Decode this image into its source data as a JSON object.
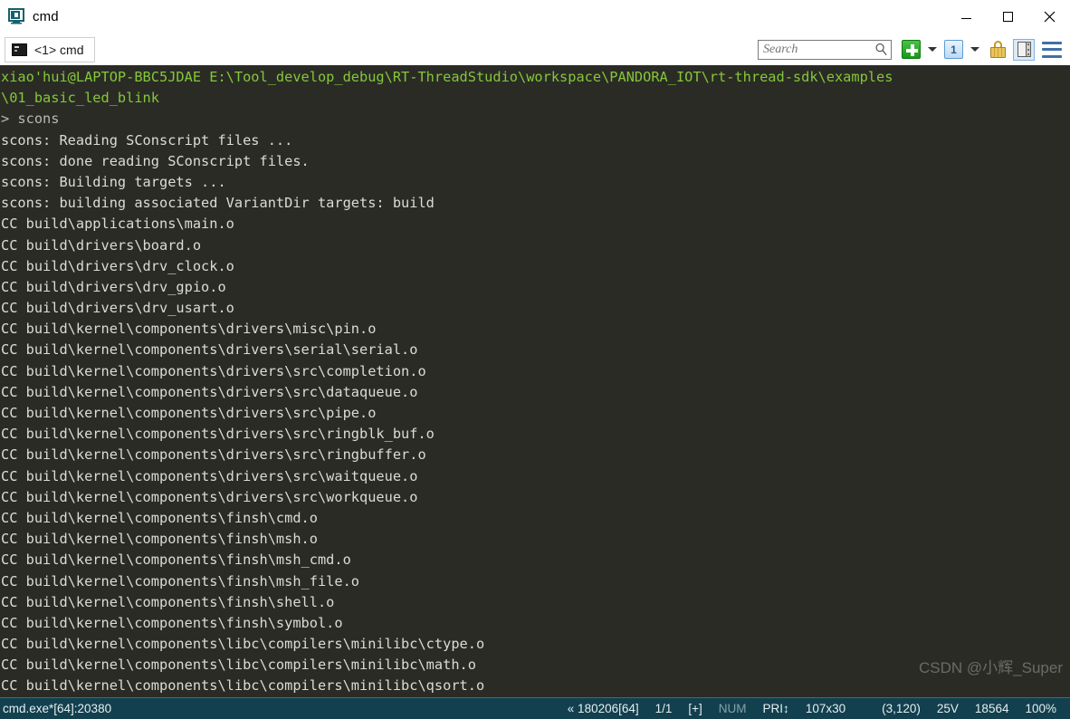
{
  "window": {
    "title": "cmd",
    "icon": "console-app-icon",
    "controls": {
      "minimize": "Minimize",
      "maximize": "Maximize",
      "close": "Close"
    }
  },
  "tabs": [
    {
      "label": "<1> cmd",
      "icon": "console-icon",
      "active": true
    }
  ],
  "toolbar": {
    "search": {
      "placeholder": "Search",
      "value": ""
    },
    "search_icon": "magnifier-icon",
    "new_console_button": "new-console-icon",
    "new_console_caret": "chevron-down-icon",
    "active_console_button": "1",
    "active_console_caret": "chevron-down-icon",
    "lock_button": "lock-icon",
    "panel_button": "toggle-panel-icon",
    "menu_button": "hamburger-menu-icon"
  },
  "terminal": {
    "background": "#2b2b26",
    "prompt_color": "#84c838",
    "text_color": "#dcdcd2",
    "lines": [
      {
        "text": "xiao'hui@LAPTOP-BBC5JDAE E:\\Tool_develop_debug\\RT-ThreadStudio\\workspace\\PANDORA_IOT\\rt-thread-sdk\\examples",
        "style": "prompt"
      },
      {
        "text": "\\01_basic_led_blink",
        "style": "prompt"
      },
      {
        "text": "> scons",
        "style": "gray"
      },
      {
        "text": "scons: Reading SConscript files ...",
        "style": "out"
      },
      {
        "text": "scons: done reading SConscript files.",
        "style": "out"
      },
      {
        "text": "scons: Building targets ...",
        "style": "out"
      },
      {
        "text": "scons: building associated VariantDir targets: build",
        "style": "out"
      },
      {
        "text": "CC build\\applications\\main.o",
        "style": "out"
      },
      {
        "text": "CC build\\drivers\\board.o",
        "style": "out"
      },
      {
        "text": "CC build\\drivers\\drv_clock.o",
        "style": "out"
      },
      {
        "text": "CC build\\drivers\\drv_gpio.o",
        "style": "out"
      },
      {
        "text": "CC build\\drivers\\drv_usart.o",
        "style": "out"
      },
      {
        "text": "CC build\\kernel\\components\\drivers\\misc\\pin.o",
        "style": "out"
      },
      {
        "text": "CC build\\kernel\\components\\drivers\\serial\\serial.o",
        "style": "out"
      },
      {
        "text": "CC build\\kernel\\components\\drivers\\src\\completion.o",
        "style": "out"
      },
      {
        "text": "CC build\\kernel\\components\\drivers\\src\\dataqueue.o",
        "style": "out"
      },
      {
        "text": "CC build\\kernel\\components\\drivers\\src\\pipe.o",
        "style": "out"
      },
      {
        "text": "CC build\\kernel\\components\\drivers\\src\\ringblk_buf.o",
        "style": "out"
      },
      {
        "text": "CC build\\kernel\\components\\drivers\\src\\ringbuffer.o",
        "style": "out"
      },
      {
        "text": "CC build\\kernel\\components\\drivers\\src\\waitqueue.o",
        "style": "out"
      },
      {
        "text": "CC build\\kernel\\components\\drivers\\src\\workqueue.o",
        "style": "out"
      },
      {
        "text": "CC build\\kernel\\components\\finsh\\cmd.o",
        "style": "out"
      },
      {
        "text": "CC build\\kernel\\components\\finsh\\msh.o",
        "style": "out"
      },
      {
        "text": "CC build\\kernel\\components\\finsh\\msh_cmd.o",
        "style": "out"
      },
      {
        "text": "CC build\\kernel\\components\\finsh\\msh_file.o",
        "style": "out"
      },
      {
        "text": "CC build\\kernel\\components\\finsh\\shell.o",
        "style": "out"
      },
      {
        "text": "CC build\\kernel\\components\\finsh\\symbol.o",
        "style": "out"
      },
      {
        "text": "CC build\\kernel\\components\\libc\\compilers\\minilibc\\ctype.o",
        "style": "out"
      },
      {
        "text": "CC build\\kernel\\components\\libc\\compilers\\minilibc\\math.o",
        "style": "out"
      },
      {
        "text": "CC build\\kernel\\components\\libc\\compilers\\minilibc\\qsort.o",
        "style": "out"
      }
    ]
  },
  "watermark": {
    "text": "CSDN @小辉_Super"
  },
  "statusbar": {
    "process": "cmd.exe*[64]:20380",
    "build": "« 180206[64]",
    "pages": "1/1",
    "insert": "[+]",
    "num": "NUM",
    "pri": "PRI↕",
    "size": "107x30",
    "cursor": "(3,120)",
    "scroll": "25V",
    "memory": "18564",
    "zoom": "100%"
  }
}
